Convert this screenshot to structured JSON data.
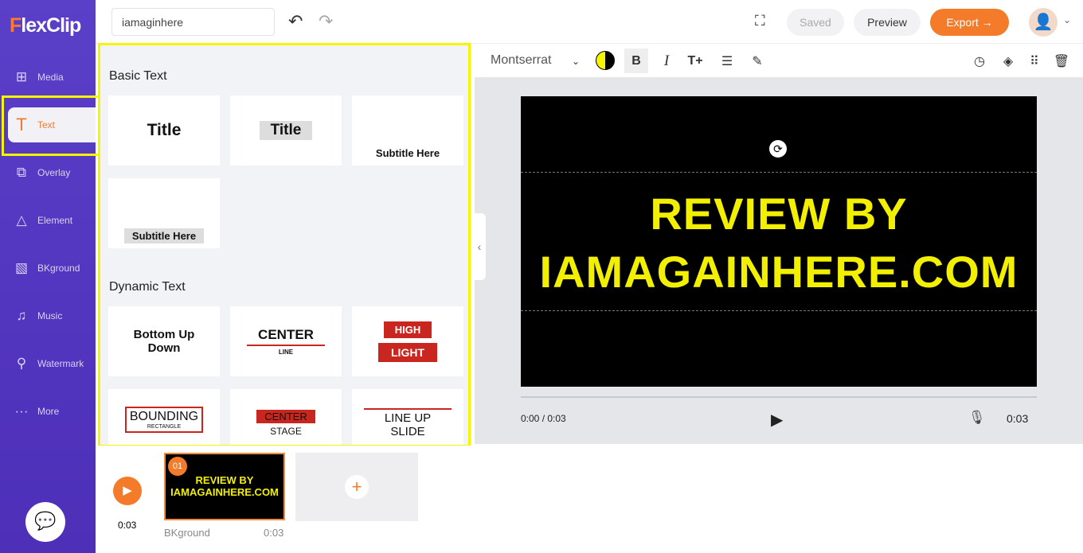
{
  "app": {
    "logo": "FlexClip",
    "project_name": "iamaginhere"
  },
  "sidebar": {
    "items": [
      {
        "label": "Media",
        "icon": "folder-plus-icon"
      },
      {
        "label": "Text",
        "icon": "text-icon"
      },
      {
        "label": "Overlay",
        "icon": "overlay-icon"
      },
      {
        "label": "Element",
        "icon": "shapes-icon"
      },
      {
        "label": "BKground",
        "icon": "background-icon"
      },
      {
        "label": "Music",
        "icon": "music-icon"
      },
      {
        "label": "Watermark",
        "icon": "stamp-icon"
      },
      {
        "label": "More",
        "icon": "more-icon"
      }
    ]
  },
  "header": {
    "saved": "Saved",
    "preview": "Preview",
    "export": "Export →"
  },
  "panel": {
    "basic_title": "Basic Text",
    "dynamic_title": "Dynamic Text",
    "basic": [
      "Title",
      "Title",
      "Subtitle Here",
      "Subtitle Here"
    ],
    "dynamic": {
      "bottom_up": "Bottom Up Down",
      "center_line_1": "CENTER",
      "center_line_2": "LINE",
      "high": "HIGH",
      "light": "LIGHT",
      "bounding": "BOUNDING",
      "rectangle": "RECTANGLE",
      "center_stage_1": "CENTER",
      "center_stage_2": "STAGE",
      "lineup_1": "LINE UP",
      "lineup_2": "SLIDE"
    }
  },
  "toolbar": {
    "font": "Montserrat",
    "text_color": "#f5f500"
  },
  "video": {
    "line1": "REVIEW BY",
    "line2": "IAMAGAINHERE.COM",
    "time": "0:00 / 0:03",
    "duration": "0:03",
    "progress": 0
  },
  "timeline": {
    "total": "0:03",
    "clip_number": "01",
    "clip_line1": "REVIEW BY",
    "clip_line2": "IAMAGAINHERE.COM",
    "clip_name": "BKground",
    "clip_duration": "0:03"
  },
  "colors": {
    "accent": "#f47b2a",
    "sidebar": "#5a3fc8",
    "highlight": "#f5f500",
    "text": "#f2f000"
  }
}
